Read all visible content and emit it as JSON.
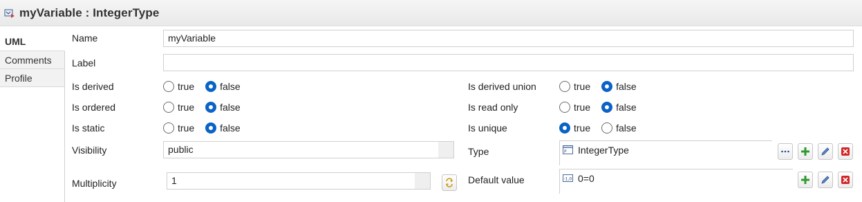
{
  "header": {
    "title": "myVariable : IntegerType",
    "icon": "variable-icon"
  },
  "tabs": [
    {
      "label": "UML",
      "active": true
    },
    {
      "label": "Comments",
      "active": false
    },
    {
      "label": "Profile",
      "active": false
    }
  ],
  "fields": {
    "name": {
      "label": "Name",
      "value": "myVariable"
    },
    "label": {
      "label": "Label",
      "value": ""
    },
    "visibility": {
      "label": "Visibility",
      "value": "public"
    },
    "multiplicity": {
      "label": "Multiplicity",
      "value": "1"
    },
    "type": {
      "label": "Type",
      "value": "IntegerType"
    },
    "default_value": {
      "label": "Default value",
      "value": "0=0"
    }
  },
  "booleans": {
    "is_derived": {
      "label": "Is derived",
      "value": false
    },
    "is_ordered": {
      "label": "Is ordered",
      "value": false
    },
    "is_static": {
      "label": "Is static",
      "value": false
    },
    "is_derived_union": {
      "label": "Is derived union",
      "value": false
    },
    "is_read_only": {
      "label": "Is read only",
      "value": false
    },
    "is_unique": {
      "label": "Is unique",
      "value": true
    }
  },
  "radio_labels": {
    "true": "true",
    "false": "false"
  },
  "colors": {
    "radio_selected": "#0a63c6",
    "add": "#2e9a2e",
    "delete": "#d42424"
  }
}
